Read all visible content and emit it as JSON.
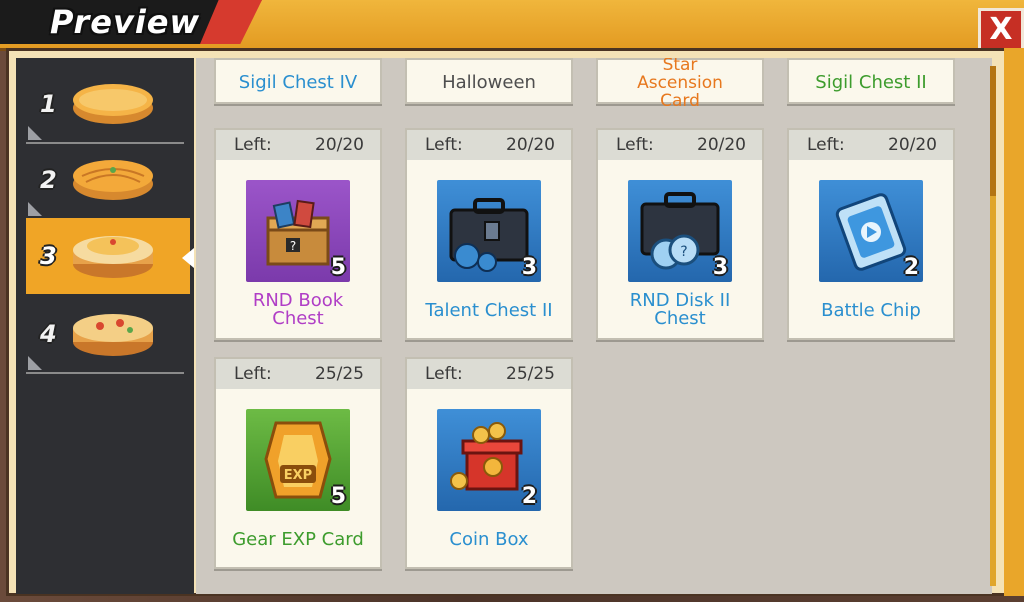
{
  "header": {
    "title": "Preview",
    "close_label": "X"
  },
  "sidebar": {
    "tiers": [
      {
        "label": "1",
        "active": false
      },
      {
        "label": "2",
        "active": false
      },
      {
        "label": "3",
        "active": true
      },
      {
        "label": "4",
        "active": false
      }
    ]
  },
  "rewards_top_partial": [
    {
      "name": "Sigil Chest IV",
      "color": "#2a8fcf"
    },
    {
      "name": "Halloween",
      "color": "#4e4e4e"
    },
    {
      "name": "Star Ascension Card",
      "color": "#e7781e"
    },
    {
      "name": "Sigil Chest II",
      "color": "#3d9c2d"
    }
  ],
  "rewards": [
    {
      "left_label": "Left:",
      "left_value": "20/20",
      "qty": "5",
      "name_line1": "RND Book",
      "name_line2": "Chest",
      "icon": "book-chest-icon",
      "color": "#b03ec6"
    },
    {
      "left_label": "Left:",
      "left_value": "20/20",
      "qty": "3",
      "name_line1": "Talent Chest II",
      "name_line2": "",
      "icon": "talent-chest-icon",
      "color": "#2a8fcf"
    },
    {
      "left_label": "Left:",
      "left_value": "20/20",
      "qty": "3",
      "name_line1": "RND Disk II",
      "name_line2": "Chest",
      "icon": "disk-chest-icon",
      "color": "#2a8fcf"
    },
    {
      "left_label": "Left:",
      "left_value": "20/20",
      "qty": "2",
      "name_line1": "Battle Chip",
      "name_line2": "",
      "icon": "battle-chip-icon",
      "color": "#2a8fcf"
    },
    {
      "left_label": "Left:",
      "left_value": "25/25",
      "qty": "5",
      "name_line1": "Gear EXP Card",
      "name_line2": "",
      "icon": "gear-exp-card-icon",
      "color": "#3d9c2d"
    },
    {
      "left_label": "Left:",
      "left_value": "25/25",
      "qty": "2",
      "name_line1": "Coin Box",
      "name_line2": "",
      "icon": "coin-box-icon",
      "color": "#2a8fcf"
    }
  ],
  "gear_exp_badge": "EXP"
}
